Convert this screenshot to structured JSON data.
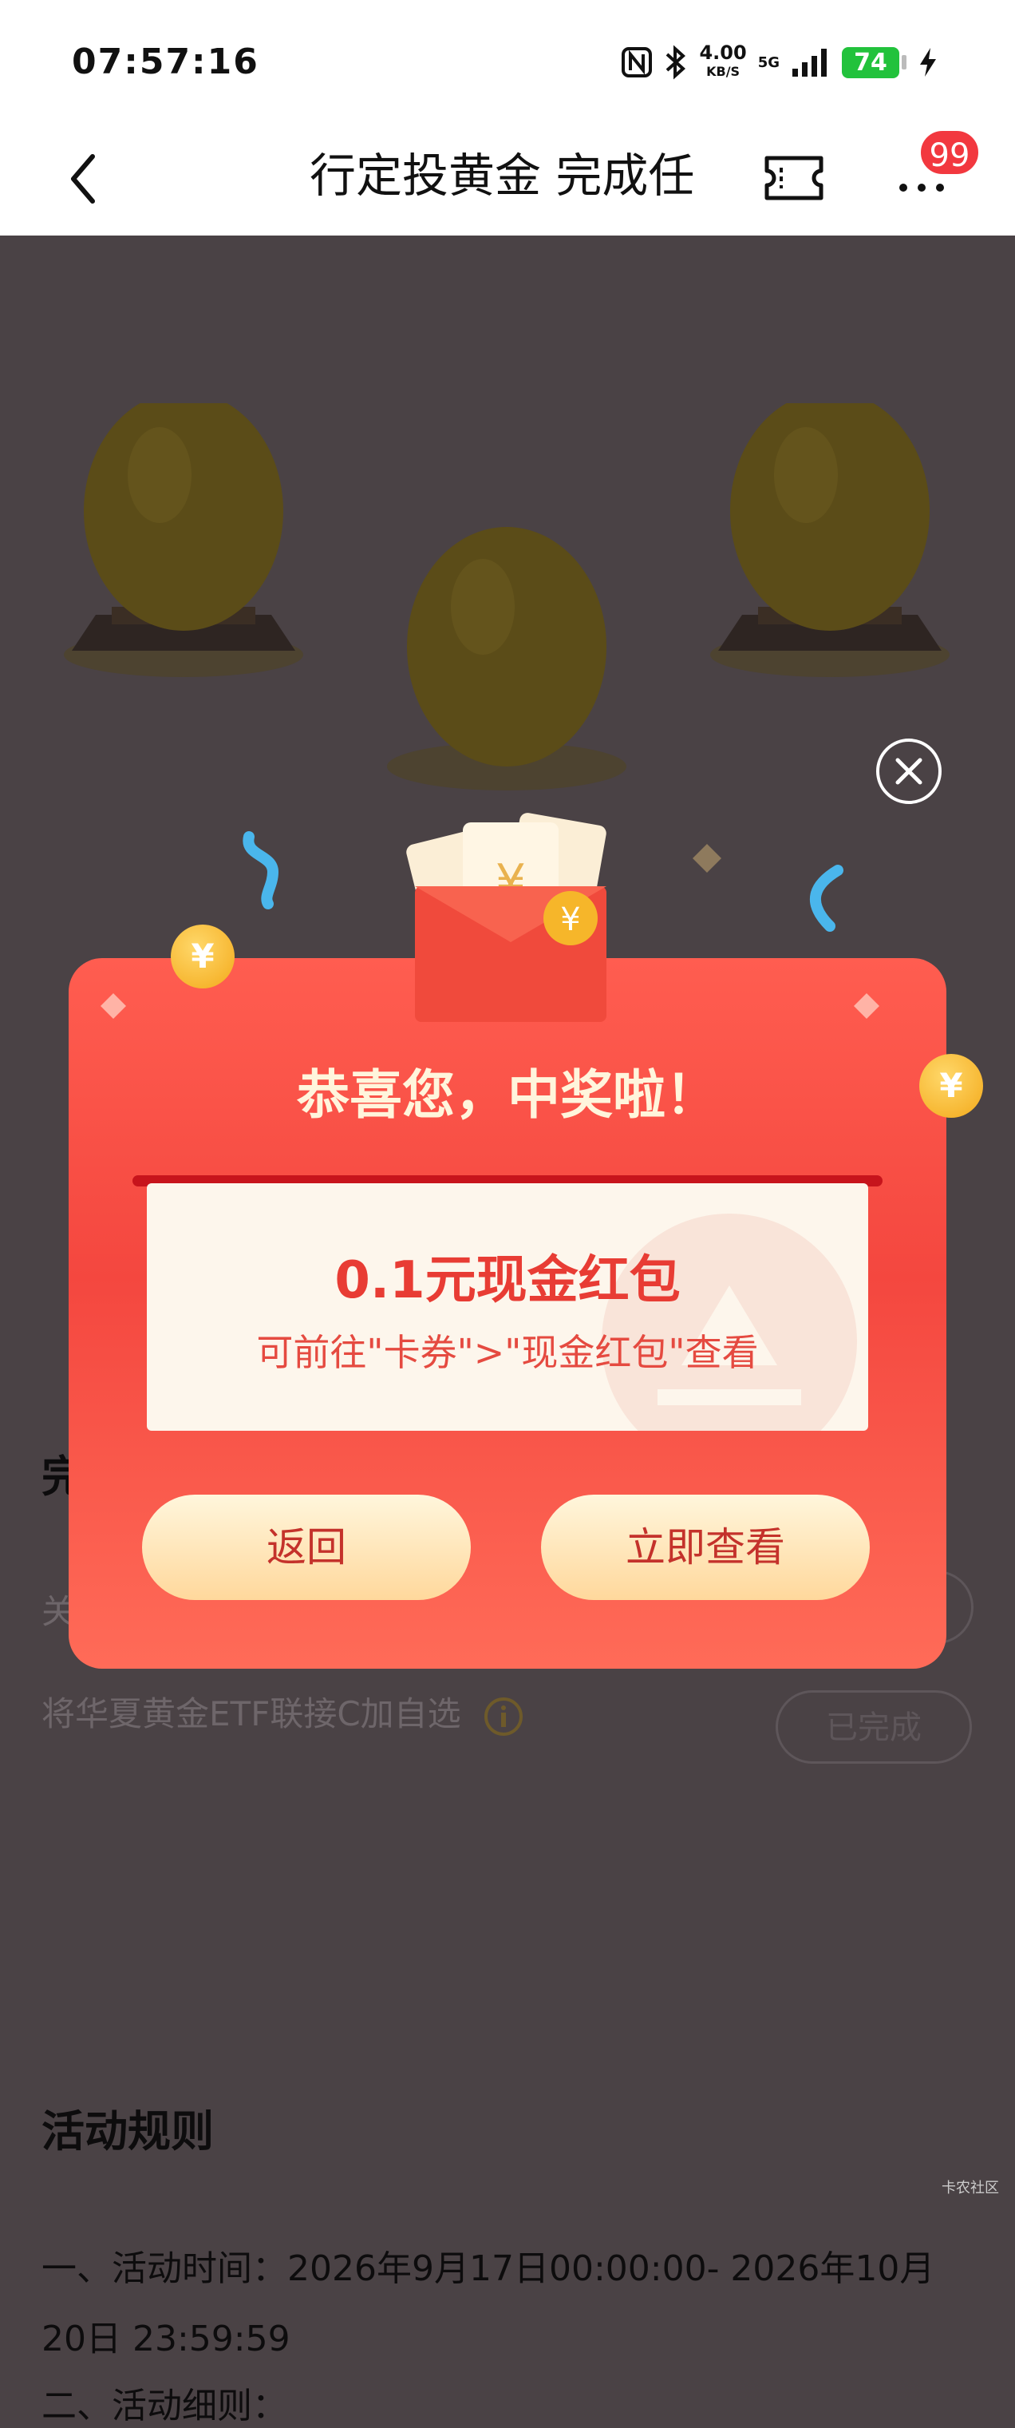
{
  "status_bar": {
    "time": "07:57:16",
    "net_speed_value": "4.00",
    "net_speed_unit": "KB/S",
    "network": "5G",
    "battery": "74"
  },
  "nav": {
    "title": "行定投黄金 完成任",
    "badge": "99"
  },
  "tasks": [
    {
      "label": "将华夏黄金ETF联接C加自选",
      "status": "已完成"
    }
  ],
  "rules": {
    "title": "活动规则",
    "lines": [
      "一、活动时间：2026年9月17日00:00:00- 2026年10月",
      "20日 23:59:59",
      "二、活动细则："
    ]
  },
  "modal": {
    "title": "恭喜您，中奖啦！",
    "amount": "0.1元现金红包",
    "hint": "可前往\"卡券\">\"现金红包\"查看",
    "back_label": "返回",
    "view_label": "立即查看"
  },
  "watermark": "卡农社区",
  "colors": {
    "modal_red": "#f4473f",
    "button_cream": "#ffe2ad",
    "battery_green": "#22c23c",
    "badge_red": "#f2383f"
  }
}
